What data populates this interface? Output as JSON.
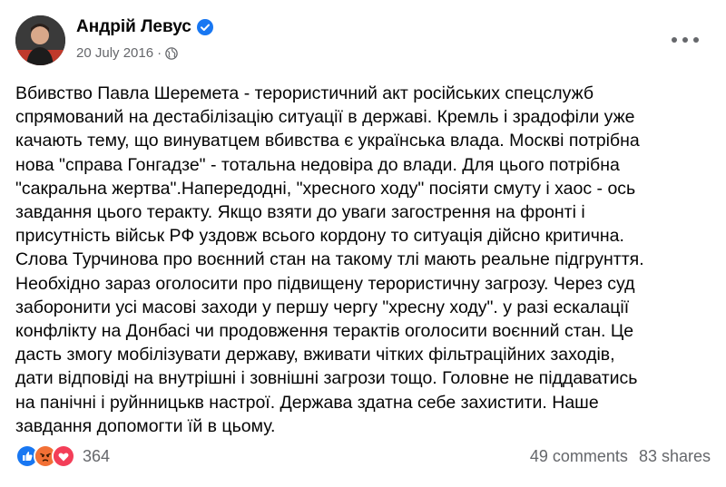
{
  "author": {
    "name": "Андрій Левус",
    "verified_icon": "verified-badge-icon"
  },
  "meta": {
    "date": "20 July 2016",
    "separator": "·",
    "privacy_icon": "globe-icon"
  },
  "post": {
    "text": "Вбивство Павла Шеремета - терористичний акт російських спецслужб\nспрямований на дестабілізацію ситуації в державі. Кремль і зрадофіли уже\nкачають тему, що винуватцем вбивства є українська влада. Москві потрібна\nнова \"справа Гонгадзе\" - тотальна недовіра до влади. Для цього потрібна\n\"сакральна жертва\".Напередодні, \"хресного ходу\" посіяти смуту і хаос - ось\nзавдання цього теракту. Якщо взяти до уваги загострення на фронті і\nприсутність військ РФ уздовж всього кордону то ситуація дійсно критична.\nСлова Турчинова про воєнний  стан на такому тлі мають реальне підгрунття.\nНеобхідно зараз оголосити про підвищену терористичну загрозу. Через суд\nзаборонити усі масові заходи у першу чергу \"хресну ходу\". у разі ескалації\nконфлікту на Донбасі чи продовження терактів оголосити воєнний стан. Це\nдасть змогу мобілізувати державу, вживати чітких фільтраційних заходів,\nдати відповіді на внутрішні і зовнішні загрози тощо. Головне не піддаватись\nна панічні і руйнницькв настрої. Держава здатна себе захистити. Наше\nзавдання допомогти їй в цьому."
  },
  "reactions": {
    "icons": [
      "like-icon",
      "angry-icon",
      "love-icon"
    ],
    "count": "364"
  },
  "stats": {
    "comments": "49 comments",
    "shares": "83 shares"
  },
  "colors": {
    "like": "#1877f2",
    "angry": "#f7714b",
    "love": "#f33e58",
    "secondary_text": "#65676b"
  }
}
